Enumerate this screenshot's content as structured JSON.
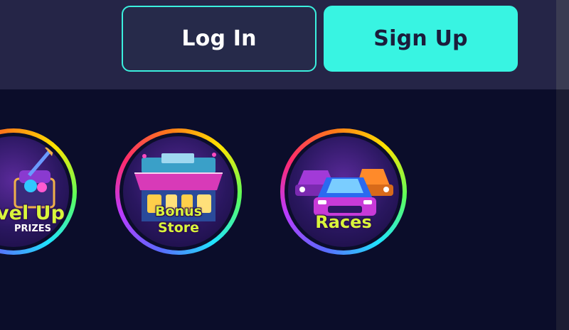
{
  "header": {
    "login_label": "Log In",
    "signup_label": "Sign Up"
  },
  "promos": [
    {
      "title": "vel Up",
      "subtitle": "PRIZES",
      "icon": "treasure-chest-arrow-icon"
    },
    {
      "title_line1": "Bonus",
      "title_line2": "Store",
      "icon": "storefront-icon"
    },
    {
      "title": "Races",
      "icon": "race-cars-icon"
    }
  ],
  "colors": {
    "accent": "#38f4e2",
    "header_bg": "#252547",
    "page_bg": "#0b0d2a",
    "label_yellow": "#d9f53b"
  }
}
